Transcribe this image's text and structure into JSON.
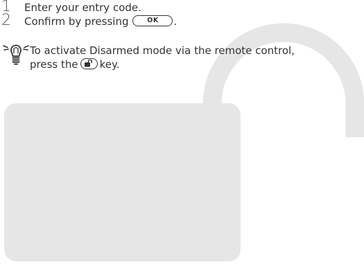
{
  "steps": [
    {
      "number": "1",
      "text": "Enter your entry code."
    },
    {
      "number": "2",
      "text_before": "Confirm by pressing",
      "key_label": "OK",
      "text_after": "."
    }
  ],
  "tip": {
    "text_line1": "To activate Disarmed mode via the remote control,",
    "text_line2_before": "press the",
    "text_line2_after": "key.",
    "key_icon": "unlock-icon"
  },
  "illustration": {
    "name": "padlock-icon",
    "color": "#e6e6e6"
  },
  "colors": {
    "text": "#333333",
    "step_number": "#555555",
    "illustration": "#e6e6e6"
  }
}
